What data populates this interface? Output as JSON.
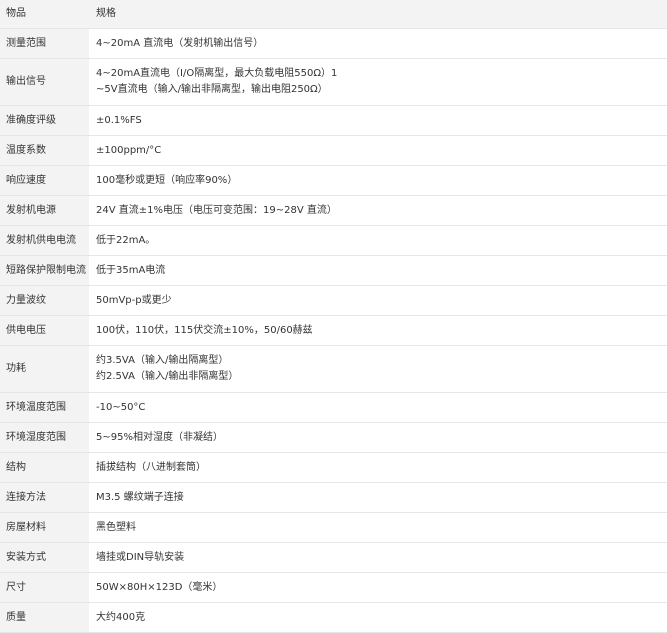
{
  "header": {
    "col1": "物品",
    "col2": "规格"
  },
  "rows": [
    {
      "label": "测量范围",
      "value": [
        "4~20mA 直流电（发射机输出信号）"
      ]
    },
    {
      "label": "输出信号",
      "value": [
        "4~20mA直流电（I/O隔离型，最大负载电阻550Ω）1",
        "~5V直流电（输入/输出非隔离型，输出电阻250Ω）"
      ]
    },
    {
      "label": "准确度评级",
      "value": [
        "±0.1%FS"
      ]
    },
    {
      "label": "温度系数",
      "value": [
        "±100ppm/°C"
      ]
    },
    {
      "label": "响应速度",
      "value": [
        "100毫秒或更短（响应率90%）"
      ]
    },
    {
      "label": "发射机电源",
      "value": [
        "24V 直流±1%电压（电压可变范围：19~28V 直流）"
      ]
    },
    {
      "label": "发射机供电电流",
      "value": [
        "低于22mA。"
      ]
    },
    {
      "label": "短路保护限制电流",
      "value": [
        "低于35mA电流"
      ]
    },
    {
      "label": "力量波纹",
      "value": [
        "50mVp-p或更少"
      ]
    },
    {
      "label": "供电电压",
      "value": [
        "100伏，110伏，115伏交流±10%，50/60赫兹"
      ]
    },
    {
      "label": "功耗",
      "value": [
        "约3.5VA（输入/输出隔离型）",
        "约2.5VA（输入/输出非隔离型）"
      ]
    },
    {
      "label": "环境温度范围",
      "value": [
        "-10~50°C"
      ]
    },
    {
      "label": "环境湿度范围",
      "value": [
        "5~95%相对湿度（非凝结）"
      ]
    },
    {
      "label": "结构",
      "value": [
        "插拔结构（八进制套筒）"
      ]
    },
    {
      "label": "连接方法",
      "value": [
        "M3.5 螺纹端子连接"
      ]
    },
    {
      "label": "房屋材料",
      "value": [
        "黑色塑料"
      ]
    },
    {
      "label": "安装方式",
      "value": [
        "墙挂或DIN导轨安装"
      ]
    },
    {
      "label": "尺寸",
      "value": [
        "50W×80H×123D（毫米）"
      ]
    },
    {
      "label": "质量",
      "value": [
        "大约400克"
      ]
    }
  ]
}
